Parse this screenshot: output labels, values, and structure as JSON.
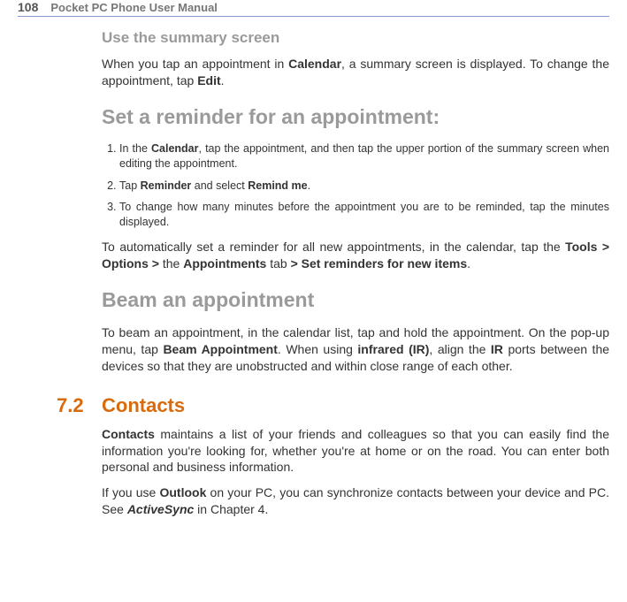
{
  "header": {
    "page_number": "108",
    "manual_title": "Pocket PC Phone User Manual"
  },
  "sec1": {
    "title": "Use the summary screen",
    "p1a": "When you tap an appointment in ",
    "p1b": "Calendar",
    "p1c": ", a summary screen is displayed. To change the appointment, tap ",
    "p1d": "Edit",
    "p1e": "."
  },
  "sec2": {
    "title": "Set a reminder for an appointment:",
    "step1a": "In the ",
    "step1b": "Calendar",
    "step1c": ", tap the appointment, and then tap the upper portion of the summary screen when editing the appointment.",
    "step2a": "Tap ",
    "step2b": "Reminder",
    "step2c": " and select ",
    "step2d": "Remind me",
    "step2e": ".",
    "step3": "To change how many minutes before the appointment you are to be reminded, tap the minutes displayed.",
    "p2a": "To automatically set a reminder for all new appointments, in the calendar, tap the ",
    "p2b": "Tools > Options >",
    "p2c": " the ",
    "p2d": "Appointments",
    "p2e": " tab ",
    "p2f": "> Set reminders for new items",
    "p2g": "."
  },
  "sec3": {
    "title": "Beam an appointment",
    "p1a": "To beam an appointment, in the calendar list, tap and hold the appointment. On the pop-up menu, tap ",
    "p1b": "Beam Appointment",
    "p1c": ". When using ",
    "p1d": "infrared (IR)",
    "p1e": ", align the ",
    "p1f": "IR",
    "p1g": " ports between the devices so that they are unobstructed and within close range of each other."
  },
  "sec4": {
    "number": "7.2",
    "title": "Contacts",
    "p1a": "Contacts",
    "p1b": " maintains a list of your friends and colleagues so that you can easily find the information you're looking for, whether you're at home or on the road. You can enter both personal and business information.",
    "p2a": "If you use ",
    "p2b": "Outlook",
    "p2c": " on your PC, you can synchronize contacts between your device and PC. See ",
    "p2d": "ActiveSync",
    "p2e": " in Chapter 4."
  }
}
